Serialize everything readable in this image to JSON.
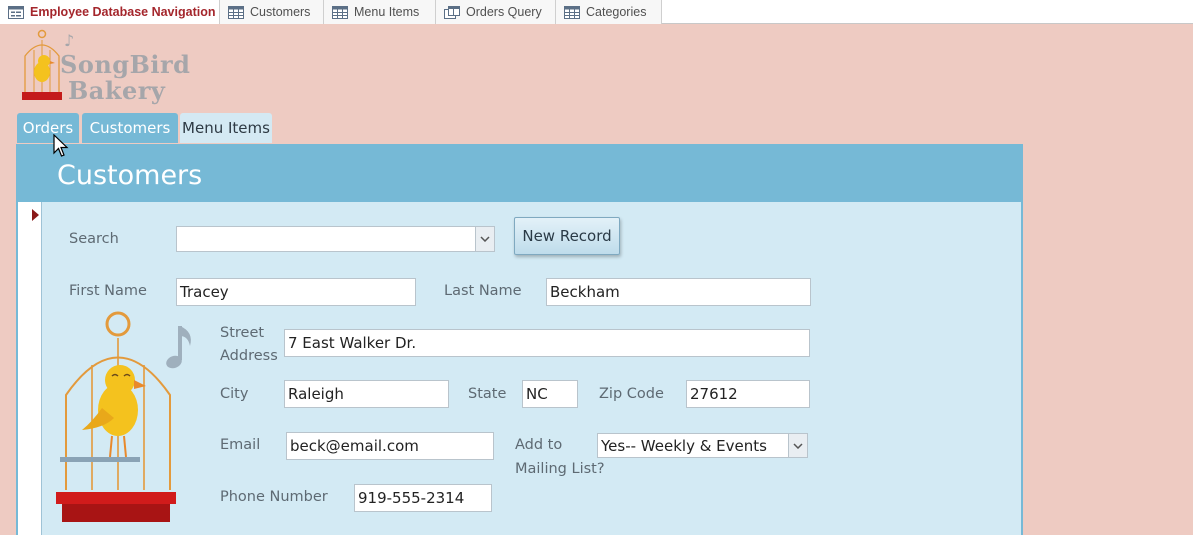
{
  "doc_tabs": [
    {
      "label": "Employee Database Navigation",
      "icon": "form-icon",
      "active": true
    },
    {
      "label": "Customers",
      "icon": "table-icon",
      "active": false
    },
    {
      "label": "Menu Items",
      "icon": "table-icon",
      "active": false
    },
    {
      "label": "Orders Query",
      "icon": "query-icon",
      "active": false
    },
    {
      "label": "Categories",
      "icon": "table-icon",
      "active": false
    }
  ],
  "logo": {
    "line1": "SongBird",
    "line2": "Bakery"
  },
  "nav": {
    "orders": "Orders",
    "customers": "Customers",
    "menu_items": "Menu Items"
  },
  "form": {
    "title": "Customers",
    "search": {
      "label": "Search",
      "value": ""
    },
    "new_record_label": "New Record",
    "first_name": {
      "label": "First Name",
      "value": "Tracey"
    },
    "last_name": {
      "label": "Last Name",
      "value": "Beckham"
    },
    "street_address": {
      "label_line1": "Street",
      "label_line2": "Address",
      "value": "7 East Walker Dr."
    },
    "city": {
      "label": "City",
      "value": "Raleigh"
    },
    "state": {
      "label": "State",
      "value": "NC"
    },
    "zip": {
      "label": "Zip Code",
      "value": "27612"
    },
    "email": {
      "label": "Email",
      "value": "beck@email.com"
    },
    "mailing_list": {
      "label_line1": "Add to",
      "label_line2": "Mailing List?",
      "value": "Yes-- Weekly & Events"
    },
    "phone": {
      "label": "Phone Number",
      "value": "919-555-2314"
    }
  },
  "colors": {
    "background": "#eecbc2",
    "accent": "#76b9d6",
    "form_body": "#d3eaf4",
    "active_tab_text": "#a4262c"
  }
}
